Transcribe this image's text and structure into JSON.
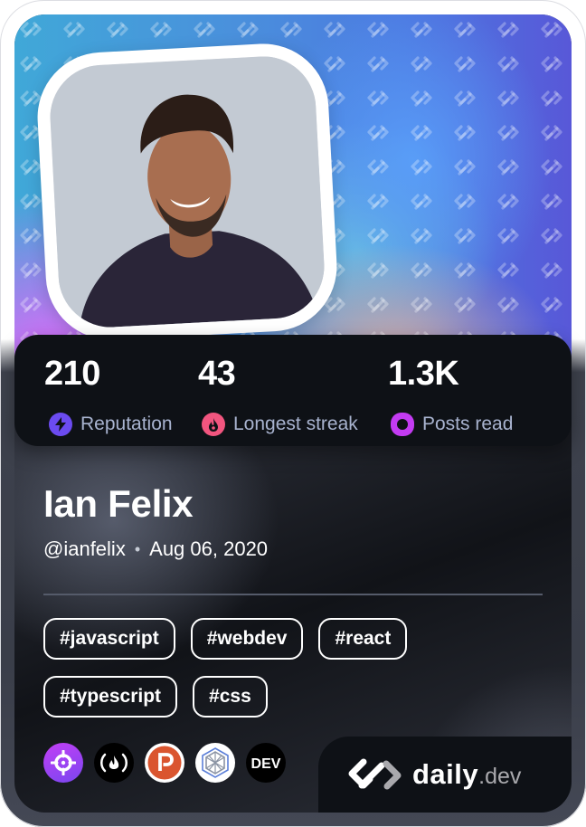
{
  "profile": {
    "name": "Ian Felix",
    "handle": "@ianfelix",
    "separator": "•",
    "joined": "Aug 06, 2020",
    "avatar_alt": "Ian Felix profile photo"
  },
  "stats": [
    {
      "value": "210",
      "label": "Reputation",
      "icon": "lightning-icon",
      "color": "#6b4bf0"
    },
    {
      "value": "43",
      "label": "Longest streak",
      "icon": "flame-icon",
      "color": "#f2557f"
    },
    {
      "value": "1.3K",
      "label": "Posts read",
      "icon": "eye-ring-icon",
      "color": "#c33bf2"
    }
  ],
  "tags": [
    "#javascript",
    "#webdev",
    "#react",
    "#typescript",
    "#css"
  ],
  "sources": [
    {
      "name": "crosshair-source-icon",
      "bg": "#a442f5",
      "label": "target"
    },
    {
      "name": "freecodecamp-source-icon",
      "bg": "#000000",
      "label": "(🔥)"
    },
    {
      "name": "producthunt-source-icon",
      "bg": "#da552f",
      "label": "P"
    },
    {
      "name": "hexagon-source-icon",
      "bg": "#ffffff",
      "label": "hex"
    },
    {
      "name": "dev-to-source-icon",
      "bg": "#000000",
      "label": "DEV"
    }
  ],
  "brand": {
    "daily": "daily",
    "dev": ".dev"
  }
}
